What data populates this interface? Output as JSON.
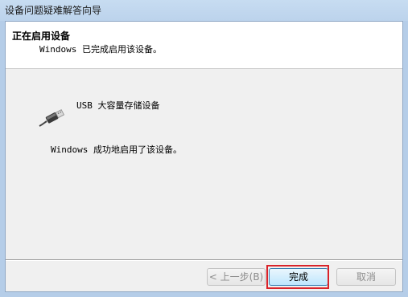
{
  "window": {
    "title": "设备问题疑难解答向导"
  },
  "header": {
    "title": "正在启用设备",
    "subtitle": "Windows 已完成启用该设备。"
  },
  "main": {
    "device_icon": "usb-plug-icon",
    "device_name": "USB 大容量存储设备",
    "status": "Windows 成功地启用了该设备。"
  },
  "buttons": {
    "back": "< 上一步(B)",
    "finish": "完成",
    "cancel": "取消"
  },
  "colors": {
    "highlight": "#d9232a"
  }
}
